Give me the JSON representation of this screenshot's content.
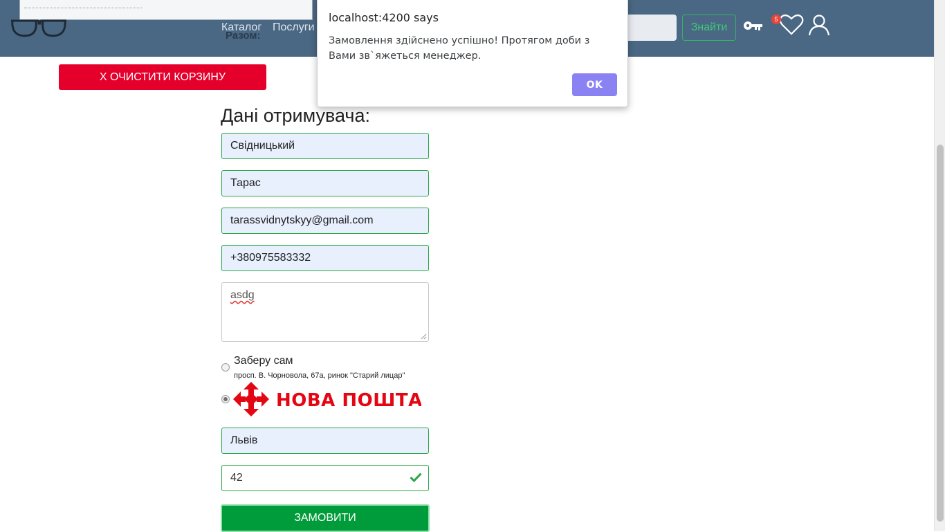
{
  "header": {
    "total_label": "Разом:",
    "nav": {
      "catalog": "Каталог",
      "services": "Послуги"
    },
    "search_button": "Знайти",
    "wishlist_count": "5"
  },
  "cart": {
    "clear_button": "X ОЧИСТИТИ КОРЗИНУ"
  },
  "form": {
    "title": "Дані отримувача:",
    "last_name": "Свідницький",
    "first_name": "Тарас",
    "email": "tarassvidnytskyy@gmail.com",
    "phone": "+380975583332",
    "comment": "asdg",
    "delivery": {
      "pickup_label": "Заберу сам",
      "pickup_address": "просп. В. Чорновола, 67а, ринок \"Старий лицар\"",
      "nova_poshta_logo_text": "НОВА ПОШТА",
      "selected": "nova_poshta"
    },
    "city": "Львів",
    "branch": "42",
    "submit_button": "ЗАМОВИТИ"
  },
  "dialog": {
    "title": "localhost:4200 says",
    "message": "Замовлення здійснено успішно! Протягом доби з Вами зв`яжеться менеджер.",
    "ok_button": "OK"
  },
  "colors": {
    "header_bg": "#4a6883",
    "clear_button_bg": "#e4002b",
    "submit_button_bg": "#009b3a",
    "field_border": "#28a745",
    "dialog_ok_bg": "#8a82f2",
    "nova_poshta_red": "#e30613"
  }
}
